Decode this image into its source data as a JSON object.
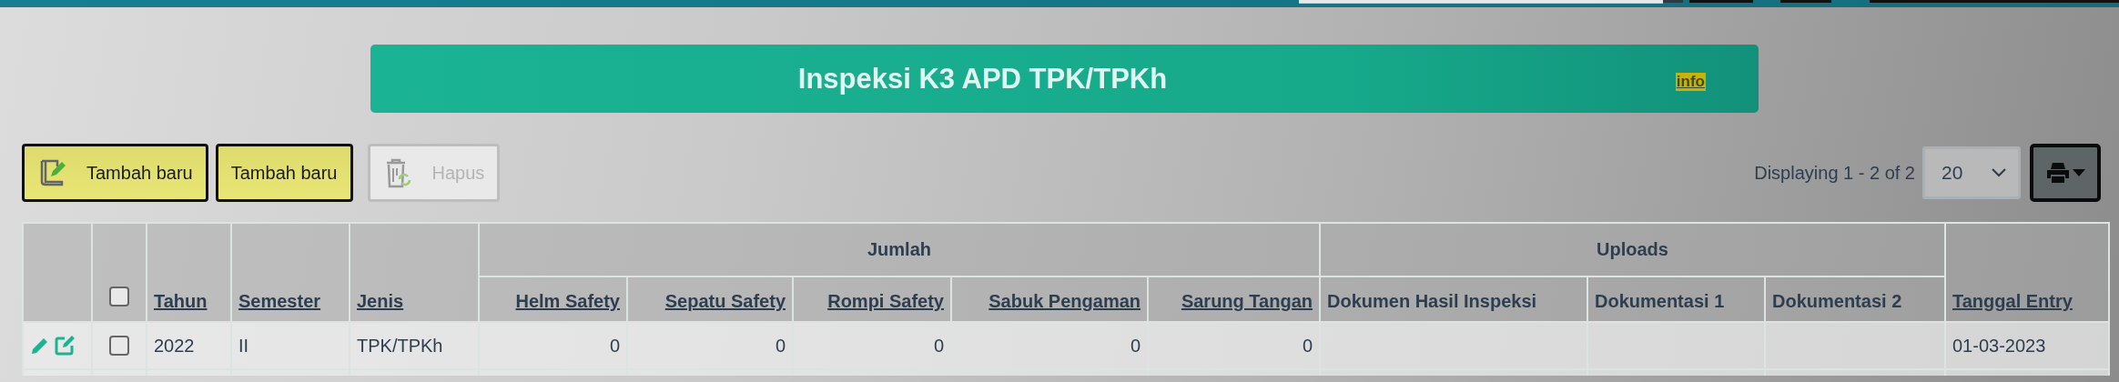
{
  "title": "Inspeksi K3 APD TPK/TPKh",
  "info_link": "info",
  "toolbar": {
    "buttons": [
      {
        "label": "Tambah baru",
        "kind": "add",
        "disabled": false
      },
      {
        "label": "Tambah baru",
        "kind": "plain",
        "disabled": false
      },
      {
        "label": "Hapus",
        "kind": "delete",
        "disabled": true
      }
    ],
    "pager_text": "Displaying 1 - 2 of 2",
    "page_size": "20"
  },
  "table": {
    "select_all_checked": false,
    "header": [
      {
        "kind": "text",
        "label": "Tahun",
        "sortable": true
      },
      {
        "kind": "text",
        "label": "Semester",
        "sortable": true
      },
      {
        "kind": "text",
        "label": "Jenis",
        "sortable": true
      },
      {
        "kind": "group",
        "label": "Jumlah",
        "columns": [
          {
            "label": "Helm Safety",
            "sortable": true,
            "kind": "number"
          },
          {
            "label": "Sepatu Safety",
            "sortable": true,
            "kind": "number"
          },
          {
            "label": "Rompi Safety",
            "sortable": true,
            "kind": "number"
          },
          {
            "label": "Sabuk Pengaman",
            "sortable": true,
            "kind": "number"
          },
          {
            "label": "Sarung Tangan",
            "sortable": true,
            "kind": "number"
          }
        ]
      },
      {
        "kind": "group",
        "label": "Uploads",
        "columns": [
          {
            "label": "Dokumen Hasil Inspeksi",
            "sortable": false,
            "kind": "file"
          },
          {
            "label": "Dokumentasi 1",
            "sortable": false,
            "kind": "file"
          },
          {
            "label": "Dokumentasi 2",
            "sortable": false,
            "kind": "file"
          }
        ]
      },
      {
        "kind": "text",
        "label": "Tanggal Entry",
        "sortable": true
      }
    ],
    "rows": [
      {
        "checked": false,
        "cells": [
          "2022",
          "II",
          "TPK/TPKh",
          "0",
          "0",
          "0",
          "0",
          "0",
          null,
          null,
          null,
          "01-03-2023"
        ]
      }
    ]
  }
}
